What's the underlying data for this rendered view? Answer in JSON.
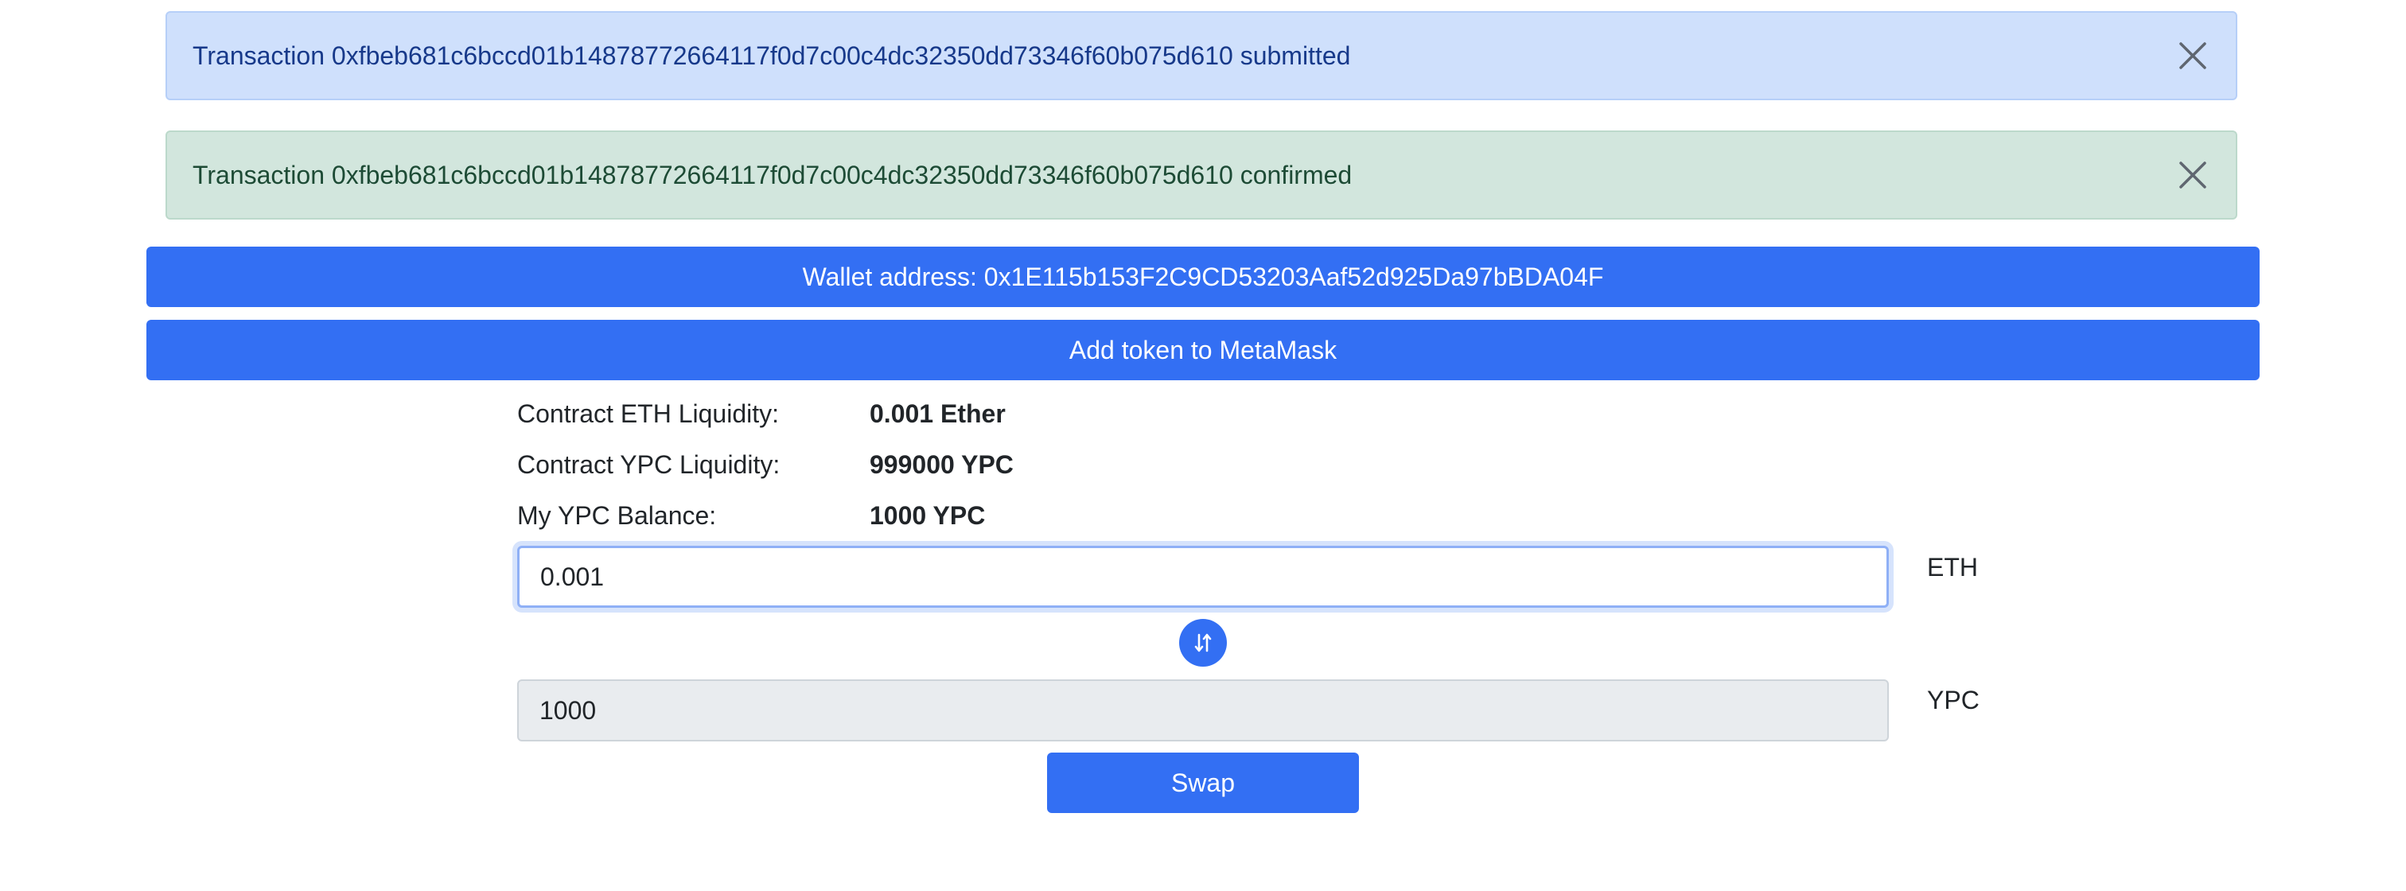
{
  "alerts": {
    "submitted": {
      "text": "Transaction 0xfbeb681c6bccd01b14878772664117f0d7c00c4dc32350dd73346f60b075d610 submitted",
      "icon": "close-icon"
    },
    "confirmed": {
      "text": "Transaction 0xfbeb681c6bccd01b14878772664117f0d7c00c4dc32350dd73346f60b075d610 confirmed",
      "icon": "close-icon"
    }
  },
  "wallet": {
    "label": "Wallet address: 0x1E115b153F2C9CD53203Aaf52d925Da97bBDA04F"
  },
  "metamask": {
    "label": "Add token to MetaMask"
  },
  "stats": [
    {
      "label": "Contract ETH Liquidity:",
      "value": "0.001 Ether"
    },
    {
      "label": "Contract YPC Liquidity:",
      "value": "999000 YPC"
    },
    {
      "label": "My YPC Balance:",
      "value": "1000 YPC"
    }
  ],
  "swap_form": {
    "from_value": "0.001",
    "from_unit": "ETH",
    "to_value": "1000",
    "to_unit": "YPC",
    "toggle_icon": "swap-arrows-icon",
    "submit_label": "Swap"
  },
  "colors": {
    "primary": "#336ff3",
    "info_bg": "#cfe0fc",
    "success_bg": "#d2e6dd"
  }
}
